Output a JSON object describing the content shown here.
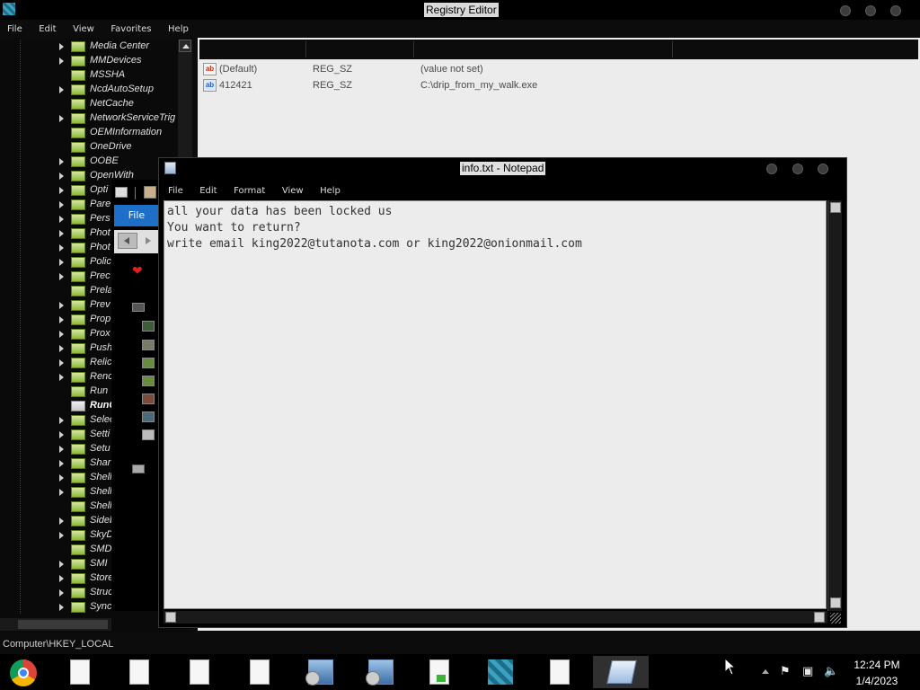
{
  "registry_editor": {
    "title": "Registry Editor",
    "menu": [
      "File",
      "Edit",
      "View",
      "Favorites",
      "Help"
    ],
    "tree_items": [
      {
        "label": "Media Center",
        "expandable": true
      },
      {
        "label": "MMDevices",
        "expandable": true
      },
      {
        "label": "MSSHA",
        "expandable": false
      },
      {
        "label": "NcdAutoSetup",
        "expandable": true
      },
      {
        "label": "NetCache",
        "expandable": false
      },
      {
        "label": "NetworkServiceTrig",
        "expandable": true
      },
      {
        "label": "OEMInformation",
        "expandable": false
      },
      {
        "label": "OneDrive",
        "expandable": false
      },
      {
        "label": "OOBE",
        "expandable": true
      },
      {
        "label": "OpenWith",
        "expandable": true
      },
      {
        "label": "Opti",
        "expandable": true
      },
      {
        "label": "Pare",
        "expandable": true
      },
      {
        "label": "Pers",
        "expandable": true
      },
      {
        "label": "Phot",
        "expandable": true
      },
      {
        "label": "Phot",
        "expandable": true
      },
      {
        "label": "Polic",
        "expandable": true
      },
      {
        "label": "Prec",
        "expandable": true
      },
      {
        "label": "Prela",
        "expandable": false
      },
      {
        "label": "Prev",
        "expandable": true
      },
      {
        "label": "Prop",
        "expandable": true
      },
      {
        "label": "Prox",
        "expandable": true
      },
      {
        "label": "Push",
        "expandable": true
      },
      {
        "label": "Relic",
        "expandable": true
      },
      {
        "label": "Renc",
        "expandable": true
      },
      {
        "label": "Run",
        "expandable": false
      },
      {
        "label": "RunC",
        "expandable": false,
        "selected": true
      },
      {
        "label": "Selec",
        "expandable": true
      },
      {
        "label": "Setti",
        "expandable": true
      },
      {
        "label": "Setu",
        "expandable": true
      },
      {
        "label": "Shar",
        "expandable": true
      },
      {
        "label": "Shell",
        "expandable": true
      },
      {
        "label": "Shell",
        "expandable": true
      },
      {
        "label": "Shell",
        "expandable": false
      },
      {
        "label": "Sideb",
        "expandable": true
      },
      {
        "label": "SkyD",
        "expandable": true
      },
      {
        "label": "SMD",
        "expandable": false
      },
      {
        "label": "SMI",
        "expandable": true
      },
      {
        "label": "Store",
        "expandable": true
      },
      {
        "label": "Struc",
        "expandable": true
      },
      {
        "label": "Sync",
        "expandable": true
      }
    ],
    "values": [
      {
        "name": "(Default)",
        "type": "REG_SZ",
        "data": "(value not set)",
        "icon": "string-value-icon"
      },
      {
        "name": "412421",
        "type": "REG_SZ",
        "data": "C:\\drip_from_my_walk.exe",
        "icon": "string-value-icon"
      }
    ],
    "status": "Computer\\HKEY_LOCAL"
  },
  "background_window": {
    "ribbon_file": "File"
  },
  "notepad": {
    "title": "info.txt - Notepad",
    "menu": [
      "File",
      "Edit",
      "Format",
      "View",
      "Help"
    ],
    "lines": [
      "all your data has been locked us",
      "You want to return?",
      "write email king2022@tutanota.com or king2022@onionmail.com"
    ]
  },
  "taskbar": {
    "items": [
      "chrome-icon",
      "document-icon",
      "document-icon",
      "document-icon",
      "document-icon",
      "setup-icon",
      "setup-icon",
      "document-green-icon",
      "regedit-icon",
      "document-icon",
      "notepad-icon"
    ],
    "time": "12:24 PM",
    "date": "1/4/2023"
  }
}
